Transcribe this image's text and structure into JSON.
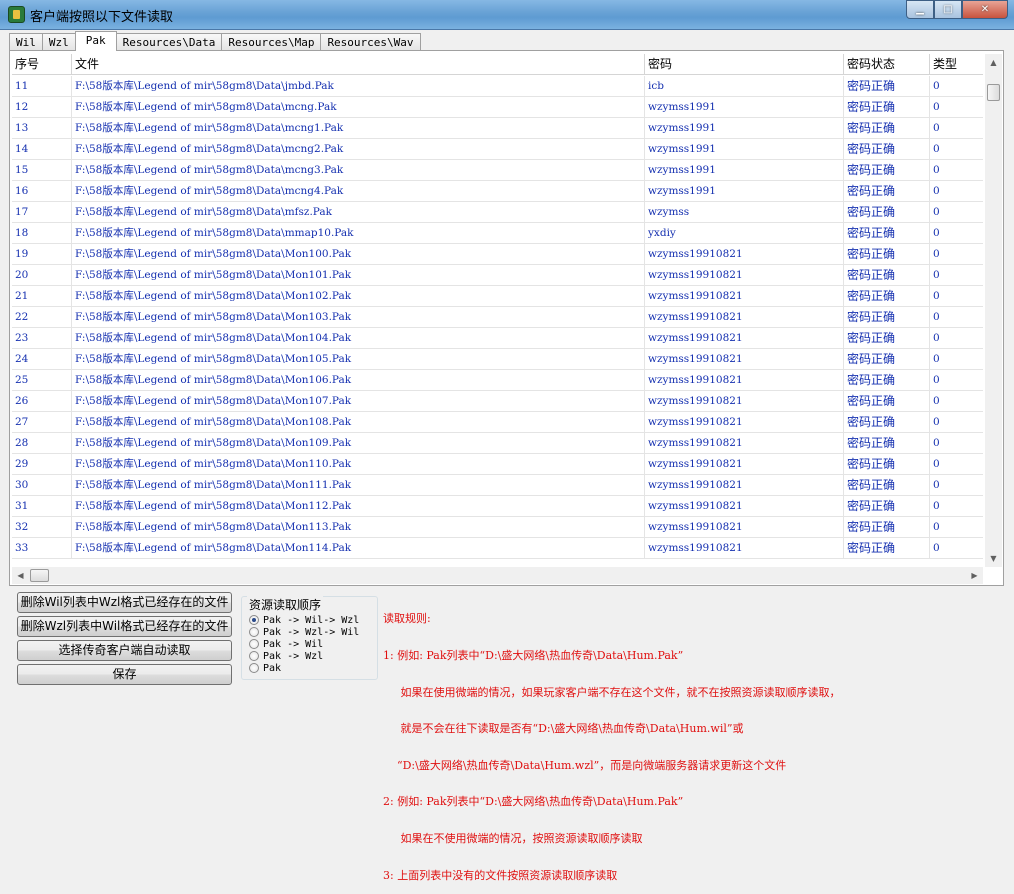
{
  "window": {
    "title": "客户端按照以下文件读取",
    "min_glyph": "▁",
    "max_glyph": "□",
    "close_glyph": "✕"
  },
  "tabs": [
    "Wil",
    "Wzl",
    "Pak",
    "Resources\\Data",
    "Resources\\Map",
    "Resources\\Wav"
  ],
  "active_tab": "Pak",
  "table": {
    "headers": [
      "序号",
      "文件",
      "密码",
      "密码状态",
      "类型"
    ],
    "rows": [
      [
        "11",
        "F:\\58版本库\\Legend of mir\\58gm8\\Data\\jmbd.Pak",
        "icb",
        "密码正确",
        "0"
      ],
      [
        "12",
        "F:\\58版本库\\Legend of mir\\58gm8\\Data\\mcng.Pak",
        "wzymss1991",
        "密码正确",
        "0"
      ],
      [
        "13",
        "F:\\58版本库\\Legend of mir\\58gm8\\Data\\mcng1.Pak",
        "wzymss1991",
        "密码正确",
        "0"
      ],
      [
        "14",
        "F:\\58版本库\\Legend of mir\\58gm8\\Data\\mcng2.Pak",
        "wzymss1991",
        "密码正确",
        "0"
      ],
      [
        "15",
        "F:\\58版本库\\Legend of mir\\58gm8\\Data\\mcng3.Pak",
        "wzymss1991",
        "密码正确",
        "0"
      ],
      [
        "16",
        "F:\\58版本库\\Legend of mir\\58gm8\\Data\\mcng4.Pak",
        "wzymss1991",
        "密码正确",
        "0"
      ],
      [
        "17",
        "F:\\58版本库\\Legend of mir\\58gm8\\Data\\mfsz.Pak",
        "wzymss",
        "密码正确",
        "0"
      ],
      [
        "18",
        "F:\\58版本库\\Legend of mir\\58gm8\\Data\\mmap10.Pak",
        "yxdiy",
        "密码正确",
        "0"
      ],
      [
        "19",
        "F:\\58版本库\\Legend of mir\\58gm8\\Data\\Mon100.Pak",
        "wzymss19910821",
        "密码正确",
        "0"
      ],
      [
        "20",
        "F:\\58版本库\\Legend of mir\\58gm8\\Data\\Mon101.Pak",
        "wzymss19910821",
        "密码正确",
        "0"
      ],
      [
        "21",
        "F:\\58版本库\\Legend of mir\\58gm8\\Data\\Mon102.Pak",
        "wzymss19910821",
        "密码正确",
        "0"
      ],
      [
        "22",
        "F:\\58版本库\\Legend of mir\\58gm8\\Data\\Mon103.Pak",
        "wzymss19910821",
        "密码正确",
        "0"
      ],
      [
        "23",
        "F:\\58版本库\\Legend of mir\\58gm8\\Data\\Mon104.Pak",
        "wzymss19910821",
        "密码正确",
        "0"
      ],
      [
        "24",
        "F:\\58版本库\\Legend of mir\\58gm8\\Data\\Mon105.Pak",
        "wzymss19910821",
        "密码正确",
        "0"
      ],
      [
        "25",
        "F:\\58版本库\\Legend of mir\\58gm8\\Data\\Mon106.Pak",
        "wzymss19910821",
        "密码正确",
        "0"
      ],
      [
        "26",
        "F:\\58版本库\\Legend of mir\\58gm8\\Data\\Mon107.Pak",
        "wzymss19910821",
        "密码正确",
        "0"
      ],
      [
        "27",
        "F:\\58版本库\\Legend of mir\\58gm8\\Data\\Mon108.Pak",
        "wzymss19910821",
        "密码正确",
        "0"
      ],
      [
        "28",
        "F:\\58版本库\\Legend of mir\\58gm8\\Data\\Mon109.Pak",
        "wzymss19910821",
        "密码正确",
        "0"
      ],
      [
        "29",
        "F:\\58版本库\\Legend of mir\\58gm8\\Data\\Mon110.Pak",
        "wzymss19910821",
        "密码正确",
        "0"
      ],
      [
        "30",
        "F:\\58版本库\\Legend of mir\\58gm8\\Data\\Mon111.Pak",
        "wzymss19910821",
        "密码正确",
        "0"
      ],
      [
        "31",
        "F:\\58版本库\\Legend of mir\\58gm8\\Data\\Mon112.Pak",
        "wzymss19910821",
        "密码正确",
        "0"
      ],
      [
        "32",
        "F:\\58版本库\\Legend of mir\\58gm8\\Data\\Mon113.Pak",
        "wzymss19910821",
        "密码正确",
        "0"
      ],
      [
        "33",
        "F:\\58版本库\\Legend of mir\\58gm8\\Data\\Mon114.Pak",
        "wzymss19910821",
        "密码正确",
        "0"
      ]
    ]
  },
  "buttons": {
    "delete_wil": "删除Wil列表中Wzl格式已经存在的文件",
    "delete_wzl": "删除Wzl列表中Wil格式已经存在的文件",
    "auto_read": "选择传奇客户端自动读取",
    "save": "保存"
  },
  "read_order": {
    "legend": "资源读取顺序",
    "options": [
      "Pak -> Wil-> Wzl",
      "Pak -> Wzl-> Wil",
      "Pak -> Wil",
      "Pak -> Wzl",
      "Pak"
    ],
    "selected_index": 0
  },
  "rules": {
    "lines": [
      "读取规则:",
      "1: 例如: Pak列表中“D:\\盛大网络\\热血传奇\\Data\\Hum.Pak”",
      "     如果在使用微端的情况，如果玩家客户端不存在这个文件，就不在按照资源读取顺序读取，",
      "     就是不会在往下读取是否有“D:\\盛大网络\\热血传奇\\Data\\Hum.wil”或",
      "    “D:\\盛大网络\\热血传奇\\Data\\Hum.wzl”，而是向微端服务器请求更新这个文件",
      "2: 例如: Pak列表中“D:\\盛大网络\\热血传奇\\Data\\Hum.Pak”",
      "     如果在不使用微端的情况，按照资源读取顺序读取",
      "3: 上面列表中没有的文件按照资源读取顺序读取"
    ]
  },
  "colors": {
    "row_text": "#1530b0",
    "rules_text": "#e01010",
    "titlebar": "#6aa3d6"
  }
}
